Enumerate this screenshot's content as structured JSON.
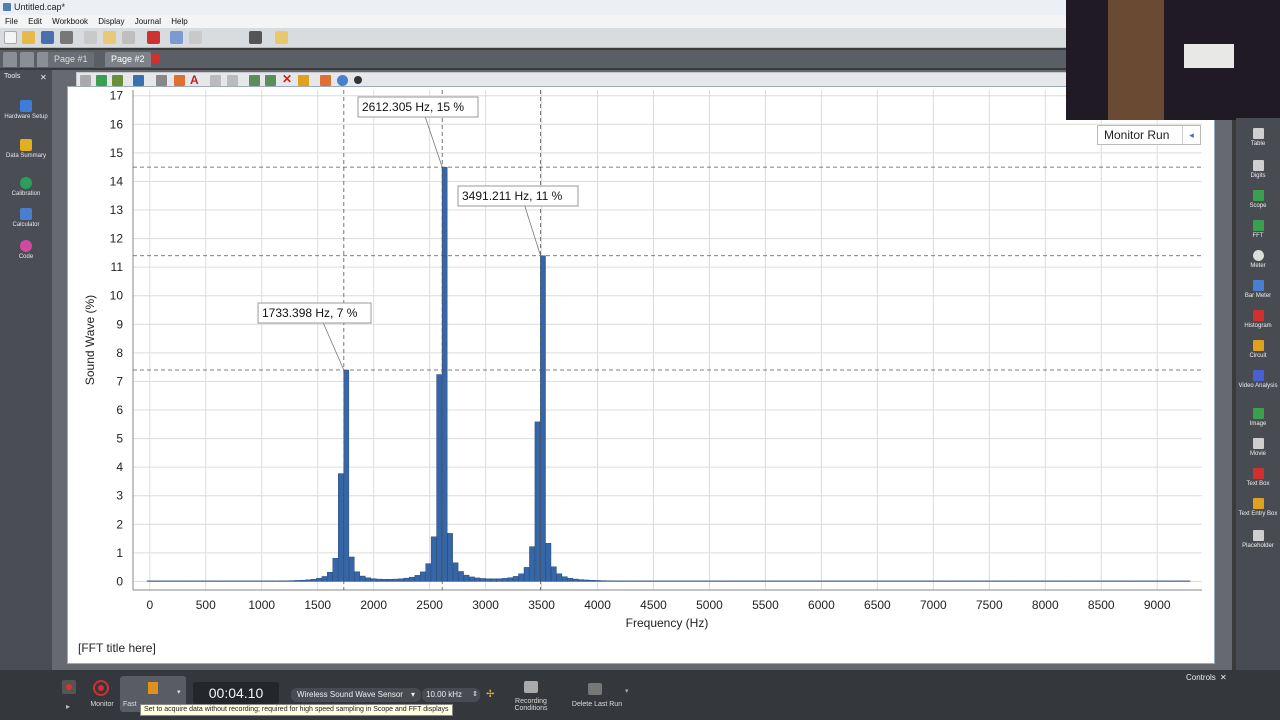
{
  "window": {
    "title": "Untitled.cap*"
  },
  "menu": [
    "File",
    "Edit",
    "Workbook",
    "Display",
    "Journal",
    "Help"
  ],
  "tabs": [
    {
      "label": "Page #1",
      "active": false
    },
    {
      "label": "Page #2",
      "active": true
    }
  ],
  "tools_panel": {
    "title": "Tools",
    "items": [
      {
        "label": "Hardware Setup",
        "icon": "hardware-icon",
        "color": "#3b7dd8"
      },
      {
        "label": "Data Summary",
        "icon": "data-summary-icon",
        "color": "#e0b020"
      },
      {
        "label": "Calibration",
        "icon": "calibration-icon",
        "color": "#2ca05a"
      },
      {
        "label": "Calculator",
        "icon": "calculator-icon",
        "color": "#4a7fd0"
      },
      {
        "label": "Code",
        "icon": "code-icon",
        "color": "#d04aa0"
      }
    ]
  },
  "displays_panel": {
    "items": [
      {
        "label": "Table",
        "icon": "table-icon",
        "color": "#cfcfcf"
      },
      {
        "label": "Digits",
        "icon": "digits-icon",
        "color": "#cfcfcf"
      },
      {
        "label": "Scope",
        "icon": "scope-icon",
        "color": "#3aa050"
      },
      {
        "label": "FFT",
        "icon": "fft-icon",
        "color": "#3aa050"
      },
      {
        "label": "Meter",
        "icon": "meter-icon",
        "color": "#dddddd"
      },
      {
        "label": "Bar Meter",
        "icon": "bar-meter-icon",
        "color": "#4a7fd0"
      },
      {
        "label": "Histogram",
        "icon": "histogram-icon",
        "color": "#d03030"
      },
      {
        "label": "Circuit",
        "icon": "circuit-icon",
        "color": "#e0a020"
      },
      {
        "label": "Video Analysis",
        "icon": "video-analysis-icon",
        "color": "#4a5fd0"
      },
      {
        "label": "Image",
        "icon": "image-icon",
        "color": "#3aa050"
      },
      {
        "label": "Movie",
        "icon": "movie-icon",
        "color": "#cfcfcf"
      },
      {
        "label": "Text Box",
        "icon": "text-box-icon",
        "color": "#d03030"
      },
      {
        "label": "Text Entry Box",
        "icon": "text-entry-icon",
        "color": "#e0a020"
      },
      {
        "label": "Placeholder",
        "icon": "placeholder-icon",
        "color": "#cfcfcf"
      }
    ]
  },
  "monitor_run": {
    "label": "Monitor Run"
  },
  "fft_title": "[FFT title here]",
  "chart_data": {
    "type": "bar",
    "xlabel": "Frequency (Hz)",
    "ylabel": "Sound Wave (%)",
    "xlim": [
      -150,
      9400
    ],
    "ylim": [
      -0.3,
      17.2
    ],
    "x_ticks": [
      0,
      500,
      1000,
      1500,
      2000,
      2500,
      3000,
      3500,
      4000,
      4500,
      5000,
      5500,
      6000,
      6500,
      7000,
      7500,
      8000,
      8500,
      9000
    ],
    "y_ticks": [
      0,
      1,
      2,
      3,
      4,
      5,
      6,
      7,
      8,
      9,
      10,
      11,
      12,
      13,
      14,
      15,
      16,
      17
    ],
    "grid": true,
    "bar_color": "#3566a8",
    "peaks": [
      {
        "freq": 1733.398,
        "value": 7.4,
        "label": "1733.398 Hz, 7 %"
      },
      {
        "freq": 2612.305,
        "value": 14.5,
        "label": "2612.305 Hz, 15 %"
      },
      {
        "freq": 3491.211,
        "value": 11.4,
        "label": "3491.211 Hz, 11 %"
      }
    ],
    "bin_width_hz": 48.8
  },
  "bottom_bar": {
    "monitor_label": "Monitor",
    "fast_label": "Fast",
    "timer": "00:04.10",
    "sensor": "Wireless Sound Wave Sensor",
    "rate": "10.00 kHz",
    "recording_conditions": "Recording Conditions",
    "delete_last_run": "Delete Last Run",
    "controls_label": "Controls",
    "tooltip": "Set to acquire data without recording; required for high speed sampling in Scope and FFT displays"
  }
}
